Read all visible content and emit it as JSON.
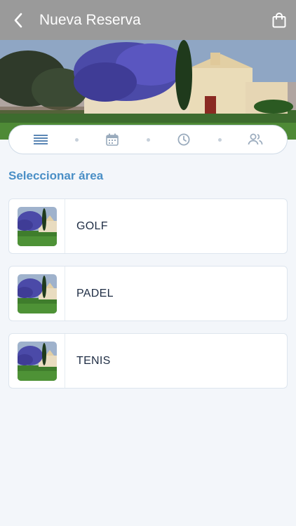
{
  "header": {
    "title": "Nueva Reserva",
    "back_icon": "chevron-left-icon",
    "cart_icon": "shopping-bag-icon"
  },
  "hero": {
    "image": "club-building-photo"
  },
  "steps": [
    {
      "icon": "list-icon",
      "active": true
    },
    {
      "icon": "calendar-icon",
      "active": false
    },
    {
      "icon": "clock-icon",
      "active": false
    },
    {
      "icon": "users-icon",
      "active": false
    }
  ],
  "section": {
    "title": "Seleccionar área"
  },
  "areas": [
    {
      "label": "GOLF",
      "image": "area-thumbnail"
    },
    {
      "label": "PADEL",
      "image": "area-thumbnail"
    },
    {
      "label": "TENIS",
      "image": "area-thumbnail"
    }
  ],
  "colors": {
    "topbar": "#9a9a9a",
    "accent": "#4a8fc6",
    "background": "#f3f6fa",
    "step_active": "#5b87b5",
    "step_inactive": "#9aabbd"
  }
}
